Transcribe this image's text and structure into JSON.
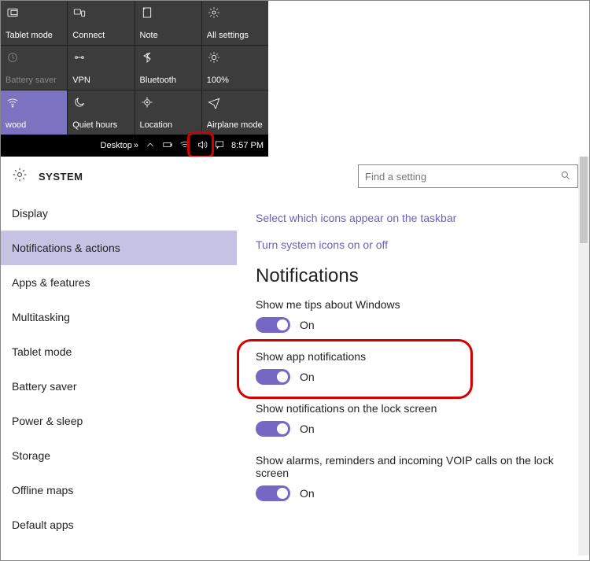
{
  "action_center": {
    "tiles": [
      {
        "label": "Tablet mode",
        "icon": "tablet-icon",
        "state": "normal"
      },
      {
        "label": "Connect",
        "icon": "connect-icon",
        "state": "normal"
      },
      {
        "label": "Note",
        "icon": "note-icon",
        "state": "normal"
      },
      {
        "label": "All settings",
        "icon": "gear-icon",
        "state": "normal"
      },
      {
        "label": "Battery saver",
        "icon": "battery-icon",
        "state": "dim"
      },
      {
        "label": "VPN",
        "icon": "vpn-icon",
        "state": "normal"
      },
      {
        "label": "Bluetooth",
        "icon": "bluetooth-icon",
        "state": "normal"
      },
      {
        "label": "100%",
        "icon": "brightness-icon",
        "state": "normal"
      },
      {
        "label": "wood",
        "icon": "wifi-icon",
        "state": "active"
      },
      {
        "label": "Quiet hours",
        "icon": "moon-icon",
        "state": "normal"
      },
      {
        "label": "Location",
        "icon": "location-icon",
        "state": "normal"
      },
      {
        "label": "Airplane mode",
        "icon": "airplane-icon",
        "state": "normal"
      }
    ]
  },
  "taskbar": {
    "desktop_label": "Desktop",
    "time": "8:57 PM"
  },
  "settings": {
    "header": {
      "title": "SYSTEM"
    },
    "search": {
      "placeholder": "Find a setting"
    },
    "sidebar": {
      "items": [
        {
          "label": "Display"
        },
        {
          "label": "Notifications & actions",
          "selected": true
        },
        {
          "label": "Apps & features"
        },
        {
          "label": "Multitasking"
        },
        {
          "label": "Tablet mode"
        },
        {
          "label": "Battery saver"
        },
        {
          "label": "Power & sleep"
        },
        {
          "label": "Storage"
        },
        {
          "label": "Offline maps"
        },
        {
          "label": "Default apps"
        }
      ]
    },
    "main": {
      "links": [
        "Select which icons appear on the taskbar",
        "Turn system icons on or off"
      ],
      "section_heading": "Notifications",
      "options": [
        {
          "label": "Show me tips about Windows",
          "state": "On"
        },
        {
          "label": "Show app notifications",
          "state": "On",
          "highlight": true
        },
        {
          "label": "Show notifications on the lock screen",
          "state": "On"
        },
        {
          "label": "Show alarms, reminders and incoming VOIP calls on the lock screen",
          "state": "On"
        }
      ]
    }
  }
}
